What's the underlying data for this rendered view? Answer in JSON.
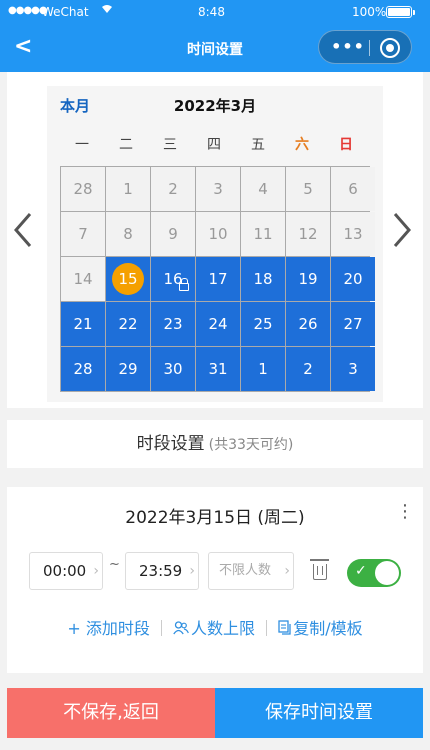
{
  "status_bar": {
    "signal": "●●●●●",
    "carrier": "WeChat",
    "wifi_icon": "wifi-icon",
    "time": "8:48",
    "battery": "100%"
  },
  "nav": {
    "back_icon": "<",
    "title": "时间设置",
    "more_label": "•••"
  },
  "calendar": {
    "this_month": "本月",
    "month_title": "2022年3月",
    "prev_arrow": "‹",
    "next_arrow": "›",
    "weekdays": [
      "一",
      "二",
      "三",
      "四",
      "五",
      "六",
      "日"
    ],
    "days": [
      {
        "d": "28",
        "s": "past"
      },
      {
        "d": "1",
        "s": "past"
      },
      {
        "d": "2",
        "s": "past"
      },
      {
        "d": "3",
        "s": "past"
      },
      {
        "d": "4",
        "s": "past"
      },
      {
        "d": "5",
        "s": "past"
      },
      {
        "d": "6",
        "s": "past"
      },
      {
        "d": "7",
        "s": "past"
      },
      {
        "d": "8",
        "s": "past"
      },
      {
        "d": "9",
        "s": "past"
      },
      {
        "d": "10",
        "s": "past"
      },
      {
        "d": "11",
        "s": "past"
      },
      {
        "d": "12",
        "s": "past"
      },
      {
        "d": "13",
        "s": "past"
      },
      {
        "d": "14",
        "s": "past"
      },
      {
        "d": "15",
        "s": "today"
      },
      {
        "d": "16",
        "s": "locked"
      },
      {
        "d": "17",
        "s": "avail"
      },
      {
        "d": "18",
        "s": "avail"
      },
      {
        "d": "19",
        "s": "avail"
      },
      {
        "d": "20",
        "s": "avail"
      },
      {
        "d": "21",
        "s": "avail"
      },
      {
        "d": "22",
        "s": "avail"
      },
      {
        "d": "23",
        "s": "avail"
      },
      {
        "d": "24",
        "s": "avail"
      },
      {
        "d": "25",
        "s": "avail"
      },
      {
        "d": "26",
        "s": "avail"
      },
      {
        "d": "27",
        "s": "avail"
      },
      {
        "d": "28",
        "s": "avail"
      },
      {
        "d": "29",
        "s": "avail"
      },
      {
        "d": "30",
        "s": "avail"
      },
      {
        "d": "31",
        "s": "avail"
      },
      {
        "d": "1",
        "s": "avail"
      },
      {
        "d": "2",
        "s": "avail"
      },
      {
        "d": "3",
        "s": "avail"
      }
    ]
  },
  "segments": {
    "title": "时段设置",
    "count_text": "(共33天可约)"
  },
  "day": {
    "date": "2022年3月15日 (周二)",
    "more_icon": "⋮",
    "start_time": "00:00",
    "tilde": "~",
    "end_time": "23:59",
    "limit_placeholder": "不限人数",
    "toggle_on": true,
    "actions": {
      "add": "+ 添加时段",
      "limit": "人数上限",
      "copy": "复制/模板"
    }
  },
  "footer": {
    "cancel": "不保存,返回",
    "save": "保存时间设置"
  },
  "colors": {
    "primary": "#2196f3",
    "available_day": "#1e6fd9",
    "today": "#f5a000",
    "cancel": "#f7706a",
    "toggle": "#3cb043"
  }
}
